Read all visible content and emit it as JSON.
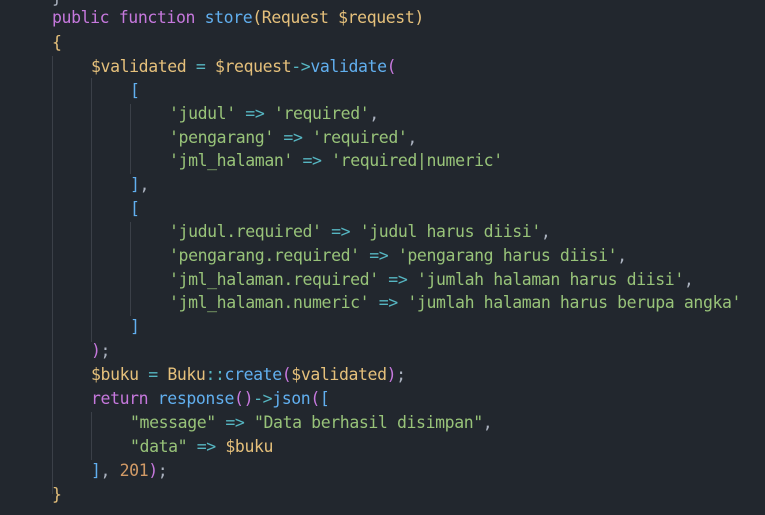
{
  "code": {
    "top_fragment": "}",
    "lines": [
      {
        "tokens": [
          [
            "kw",
            "public"
          ],
          [
            "pun",
            " "
          ],
          [
            "kw",
            "function"
          ],
          [
            "pun",
            " "
          ],
          [
            "fn",
            "store"
          ],
          [
            "br1",
            "("
          ],
          [
            "cls",
            "Request"
          ],
          [
            "pun",
            " "
          ],
          [
            "var",
            "$request"
          ],
          [
            "br1",
            ")"
          ]
        ]
      },
      {
        "tokens": [
          [
            "br1",
            "{"
          ]
        ]
      },
      {
        "tokens": [
          [
            "var",
            "$validated"
          ],
          [
            "pun",
            " "
          ],
          [
            "op",
            "="
          ],
          [
            "pun",
            " "
          ],
          [
            "var",
            "$request"
          ],
          [
            "op",
            "->"
          ],
          [
            "fn",
            "validate"
          ],
          [
            "br2",
            "("
          ]
        ]
      },
      {
        "tokens": [
          [
            "br3",
            "["
          ]
        ]
      },
      {
        "tokens": [
          [
            "str",
            "'judul'"
          ],
          [
            "pun",
            " "
          ],
          [
            "op",
            "=>"
          ],
          [
            "pun",
            " "
          ],
          [
            "str",
            "'required'"
          ],
          [
            "pun",
            ","
          ]
        ]
      },
      {
        "tokens": [
          [
            "str",
            "'pengarang'"
          ],
          [
            "pun",
            " "
          ],
          [
            "op",
            "=>"
          ],
          [
            "pun",
            " "
          ],
          [
            "str",
            "'required'"
          ],
          [
            "pun",
            ","
          ]
        ]
      },
      {
        "tokens": [
          [
            "str",
            "'jml_halaman'"
          ],
          [
            "pun",
            " "
          ],
          [
            "op",
            "=>"
          ],
          [
            "pun",
            " "
          ],
          [
            "str",
            "'required|numeric'"
          ]
        ]
      },
      {
        "tokens": [
          [
            "br3",
            "]"
          ],
          [
            "pun",
            ","
          ]
        ]
      },
      {
        "tokens": [
          [
            "br3",
            "["
          ]
        ]
      },
      {
        "tokens": [
          [
            "str",
            "'judul.required'"
          ],
          [
            "pun",
            " "
          ],
          [
            "op",
            "=>"
          ],
          [
            "pun",
            " "
          ],
          [
            "str",
            "'judul harus diisi'"
          ],
          [
            "pun",
            ","
          ]
        ]
      },
      {
        "tokens": [
          [
            "str",
            "'pengarang.required'"
          ],
          [
            "pun",
            " "
          ],
          [
            "op",
            "=>"
          ],
          [
            "pun",
            " "
          ],
          [
            "str",
            "'pengarang harus diisi'"
          ],
          [
            "pun",
            ","
          ]
        ]
      },
      {
        "tokens": [
          [
            "str",
            "'jml_halaman.required'"
          ],
          [
            "pun",
            " "
          ],
          [
            "op",
            "=>"
          ],
          [
            "pun",
            " "
          ],
          [
            "str",
            "'jumlah halaman harus diisi'"
          ],
          [
            "pun",
            ","
          ]
        ]
      },
      {
        "tokens": [
          [
            "str",
            "'jml_halaman.numeric'"
          ],
          [
            "pun",
            " "
          ],
          [
            "op",
            "=>"
          ],
          [
            "pun",
            " "
          ],
          [
            "str",
            "'jumlah halaman harus berupa angka'"
          ]
        ]
      },
      {
        "tokens": [
          [
            "br3",
            "]"
          ]
        ]
      },
      {
        "tokens": [
          [
            "br2",
            ")"
          ],
          [
            "pun",
            ";"
          ]
        ]
      },
      {
        "tokens": [
          [
            "var",
            "$buku"
          ],
          [
            "pun",
            " "
          ],
          [
            "op",
            "="
          ],
          [
            "pun",
            " "
          ],
          [
            "cls",
            "Buku"
          ],
          [
            "op",
            "::"
          ],
          [
            "fn",
            "create"
          ],
          [
            "br2",
            "("
          ],
          [
            "var",
            "$validated"
          ],
          [
            "br2",
            ")"
          ],
          [
            "pun",
            ";"
          ]
        ]
      },
      {
        "tokens": [
          [
            "kw",
            "return"
          ],
          [
            "pun",
            " "
          ],
          [
            "fn",
            "response"
          ],
          [
            "br2",
            "()"
          ],
          [
            "op",
            "->"
          ],
          [
            "fn",
            "json"
          ],
          [
            "br2",
            "("
          ],
          [
            "br3",
            "["
          ]
        ]
      },
      {
        "tokens": [
          [
            "str",
            "\"message\""
          ],
          [
            "pun",
            " "
          ],
          [
            "op",
            "=>"
          ],
          [
            "pun",
            " "
          ],
          [
            "str",
            "\"Data berhasil disimpan\""
          ],
          [
            "pun",
            ","
          ]
        ]
      },
      {
        "tokens": [
          [
            "str",
            "\"data\""
          ],
          [
            "pun",
            " "
          ],
          [
            "op",
            "=>"
          ],
          [
            "pun",
            " "
          ],
          [
            "var",
            "$buku"
          ]
        ]
      },
      {
        "tokens": [
          [
            "br3",
            "]"
          ],
          [
            "pun",
            ", "
          ],
          [
            "num",
            "201"
          ],
          [
            "br2",
            ")"
          ],
          [
            "pun",
            ";"
          ]
        ]
      },
      {
        "tokens": [
          [
            "br1",
            "}"
          ]
        ]
      }
    ]
  }
}
